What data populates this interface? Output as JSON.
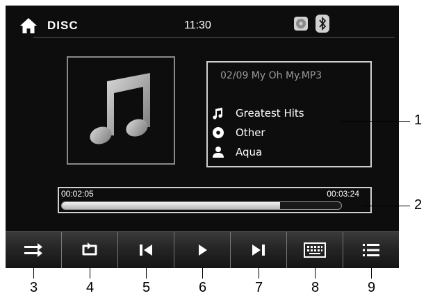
{
  "header": {
    "home_icon": "home-icon",
    "title": "DISC",
    "time": "11:30",
    "status_icons": [
      "disc-icon",
      "bluetooth-icon"
    ]
  },
  "album_art": {
    "icon": "music-note-icon"
  },
  "info": {
    "track": "02/09  My Oh My.MP3",
    "album": "Greatest Hits",
    "genre": "Other",
    "artist": "Aqua"
  },
  "progress": {
    "elapsed": "00:02:05",
    "total": "00:03:24",
    "fraction": 0.78
  },
  "controls": [
    {
      "name": "shuffle-button",
      "icon": "shuffle-icon",
      "callout": "3"
    },
    {
      "name": "repeat-button",
      "icon": "repeat-icon",
      "callout": "4"
    },
    {
      "name": "previous-button",
      "icon": "skip-previous-icon",
      "callout": "5"
    },
    {
      "name": "play-button",
      "icon": "play-icon",
      "callout": "6"
    },
    {
      "name": "next-button",
      "icon": "skip-next-icon",
      "callout": "7"
    },
    {
      "name": "keypad-button",
      "icon": "keyboard-icon",
      "callout": "8"
    },
    {
      "name": "list-button",
      "icon": "list-icon",
      "callout": "9"
    }
  ],
  "callouts": {
    "info_box": "1",
    "progress_bar": "2"
  },
  "colors": {
    "screen_bg": "#0d0d0d",
    "text": "#ffffff",
    "track_text": "#9a9a9a"
  }
}
